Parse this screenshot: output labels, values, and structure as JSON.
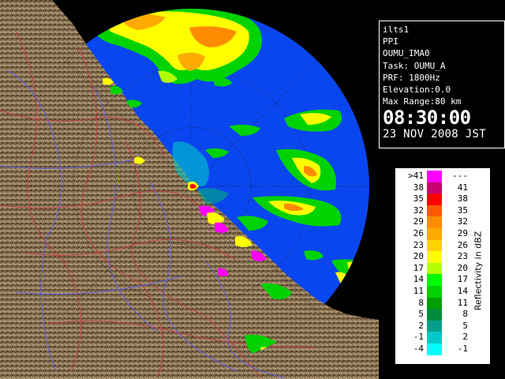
{
  "info": {
    "station": "ilts1",
    "product": "PPI",
    "site_code": "OUMU_IMA0",
    "task": "Task: OUMU_A",
    "prf": "PRF: 1800Hz",
    "elevation": "Elevation:0.0",
    "max_range": "Max Range:80 km",
    "time": "08:30:00",
    "date": "23 NOV 2008 JST"
  },
  "legend": {
    "unit_label": "Reflectivity in dBZ",
    "rows": [
      {
        "lo": ">41",
        "hi": "---",
        "color": "#ff00ff"
      },
      {
        "lo": "38",
        "hi": "41",
        "color": "#c8006e"
      },
      {
        "lo": "35",
        "hi": "38",
        "color": "#ff0000"
      },
      {
        "lo": "32",
        "hi": "35",
        "color": "#ff5a00"
      },
      {
        "lo": "29",
        "hi": "32",
        "color": "#ff8c00"
      },
      {
        "lo": "26",
        "hi": "29",
        "color": "#ffaa00"
      },
      {
        "lo": "23",
        "hi": "26",
        "color": "#ffd200"
      },
      {
        "lo": "20",
        "hi": "23",
        "color": "#ffff00"
      },
      {
        "lo": "17",
        "hi": "20",
        "color": "#b4ff00"
      },
      {
        "lo": "14",
        "hi": "17",
        "color": "#00ff00"
      },
      {
        "lo": "11",
        "hi": "14",
        "color": "#00d200"
      },
      {
        "lo": "8",
        "hi": "11",
        "color": "#00a000"
      },
      {
        "lo": "5",
        "hi": "8",
        "color": "#008c3c"
      },
      {
        "lo": "2",
        "hi": "5",
        "color": "#00a08c"
      },
      {
        "lo": "-1",
        "hi": "2",
        "color": "#00c8c8"
      },
      {
        "lo": "-4",
        "hi": "-1",
        "color": "#00ffff"
      }
    ]
  },
  "colors": {
    "sea_radar": "#0a46f0",
    "land": "#8a7050",
    "background": "#000000"
  }
}
